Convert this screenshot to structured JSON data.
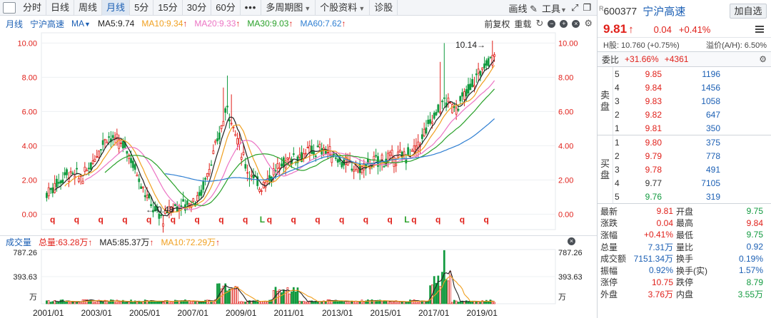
{
  "toolbar": {
    "tabs": [
      "分时",
      "日线",
      "周线",
      "月线",
      "5分",
      "15分",
      "30分",
      "60分"
    ],
    "active_tab": "月线",
    "more": "•••",
    "multi_period": "多周期图",
    "stock_info": "个股资料",
    "diagnose": "诊股",
    "draw": "画线",
    "tools": "工具"
  },
  "ma_bar": {
    "period": "月线",
    "name": "宁沪高速",
    "ma_selector": "MA",
    "ma5": "MA5:9.74",
    "ma10": "MA10:9.34",
    "ma20": "MA20:9.33",
    "ma30": "MA30:9.03",
    "ma60": "MA60:7.62",
    "fq": "前复权",
    "overlay": "重载"
  },
  "colors": {
    "up": "#e0201a",
    "down": "#119a3f",
    "ma5": "#222222",
    "ma10": "#f0a020",
    "ma20": "#ec74c4",
    "ma30": "#2aa12a",
    "ma60": "#2f7fd2"
  },
  "main_chart": {
    "y_ticks": [
      "10.00",
      "8.00",
      "6.00",
      "4.00",
      "2.00",
      "0.00"
    ],
    "y_values": [
      10,
      8,
      6,
      4,
      2,
      0
    ],
    "high_label": "10.14",
    "low_label": "-0.48",
    "marker_q": "q",
    "marker_l": "L"
  },
  "volume": {
    "title": "成交量",
    "total": "总量:63.28万",
    "ma5": "MA5:85.37万",
    "ma10": "MA10:72.29万",
    "y_ticks": [
      "787.26",
      "393.63",
      "万"
    ]
  },
  "x_axis": [
    "2001/01",
    "2003/01",
    "2005/01",
    "2007/01",
    "2009/01",
    "2011/01",
    "2013/01",
    "2015/01",
    "2017/01",
    "2019/01"
  ],
  "side": {
    "code": "600377",
    "code_prefix": "R",
    "name": "宁沪高速",
    "add_button": "加自选",
    "price": "9.81",
    "price_arrow": "↑",
    "change": "0.04",
    "change_pct": "+0.41%",
    "h_share": "H股: 10.760 (+0.75%)",
    "premium": "溢价(A/H): 6.50%",
    "weibi_label": "委比",
    "weibi_pct": "+31.66%",
    "weibi_diff": "+4361",
    "sell_label": "卖盘",
    "buy_label": "买盘",
    "asks": [
      {
        "level": "5",
        "price": "9.85",
        "vol": "1196",
        "dir": "up"
      },
      {
        "level": "4",
        "price": "9.84",
        "vol": "1456",
        "dir": "up"
      },
      {
        "level": "3",
        "price": "9.83",
        "vol": "1058",
        "dir": "up"
      },
      {
        "level": "2",
        "price": "9.82",
        "vol": "647",
        "dir": "up"
      },
      {
        "level": "1",
        "price": "9.81",
        "vol": "350",
        "dir": "up"
      }
    ],
    "bids": [
      {
        "level": "1",
        "price": "9.80",
        "vol": "375",
        "dir": "up"
      },
      {
        "level": "2",
        "price": "9.79",
        "vol": "778",
        "dir": "up"
      },
      {
        "level": "3",
        "price": "9.78",
        "vol": "491",
        "dir": "up"
      },
      {
        "level": "4",
        "price": "9.77",
        "vol": "7105",
        "dir": "flat"
      },
      {
        "level": "5",
        "price": "9.76",
        "vol": "319",
        "dir": "down"
      }
    ],
    "stats": [
      {
        "k1": "最新",
        "v1": "9.81",
        "c1": "up",
        "k2": "开盘",
        "v2": "9.75",
        "c2": "down"
      },
      {
        "k1": "涨跌",
        "v1": "0.04",
        "c1": "up",
        "k2": "最高",
        "v2": "9.84",
        "c2": "up"
      },
      {
        "k1": "涨幅",
        "v1": "+0.41%",
        "c1": "up",
        "k2": "最低",
        "v2": "9.75",
        "c2": "down"
      },
      {
        "k1": "总量",
        "v1": "7.31万",
        "c1": "blue",
        "k2": "量比",
        "v2": "0.92",
        "c2": "blue"
      },
      {
        "k1": "成交额",
        "v1": "7151.34万",
        "c1": "blue",
        "k2": "换手",
        "v2": "0.19%",
        "c2": "blue"
      },
      {
        "k1": "振幅",
        "v1": "0.92%",
        "c1": "blue",
        "k2": "换手(实)",
        "v2": "1.57%",
        "c2": "blue"
      },
      {
        "k1": "涨停",
        "v1": "10.75",
        "c1": "up",
        "k2": "跌停",
        "v2": "8.79",
        "c2": "down"
      },
      {
        "k1": "外盘",
        "v1": "3.76万",
        "c1": "up",
        "k2": "内盘",
        "v2": "3.55万",
        "c2": "down"
      }
    ]
  }
}
